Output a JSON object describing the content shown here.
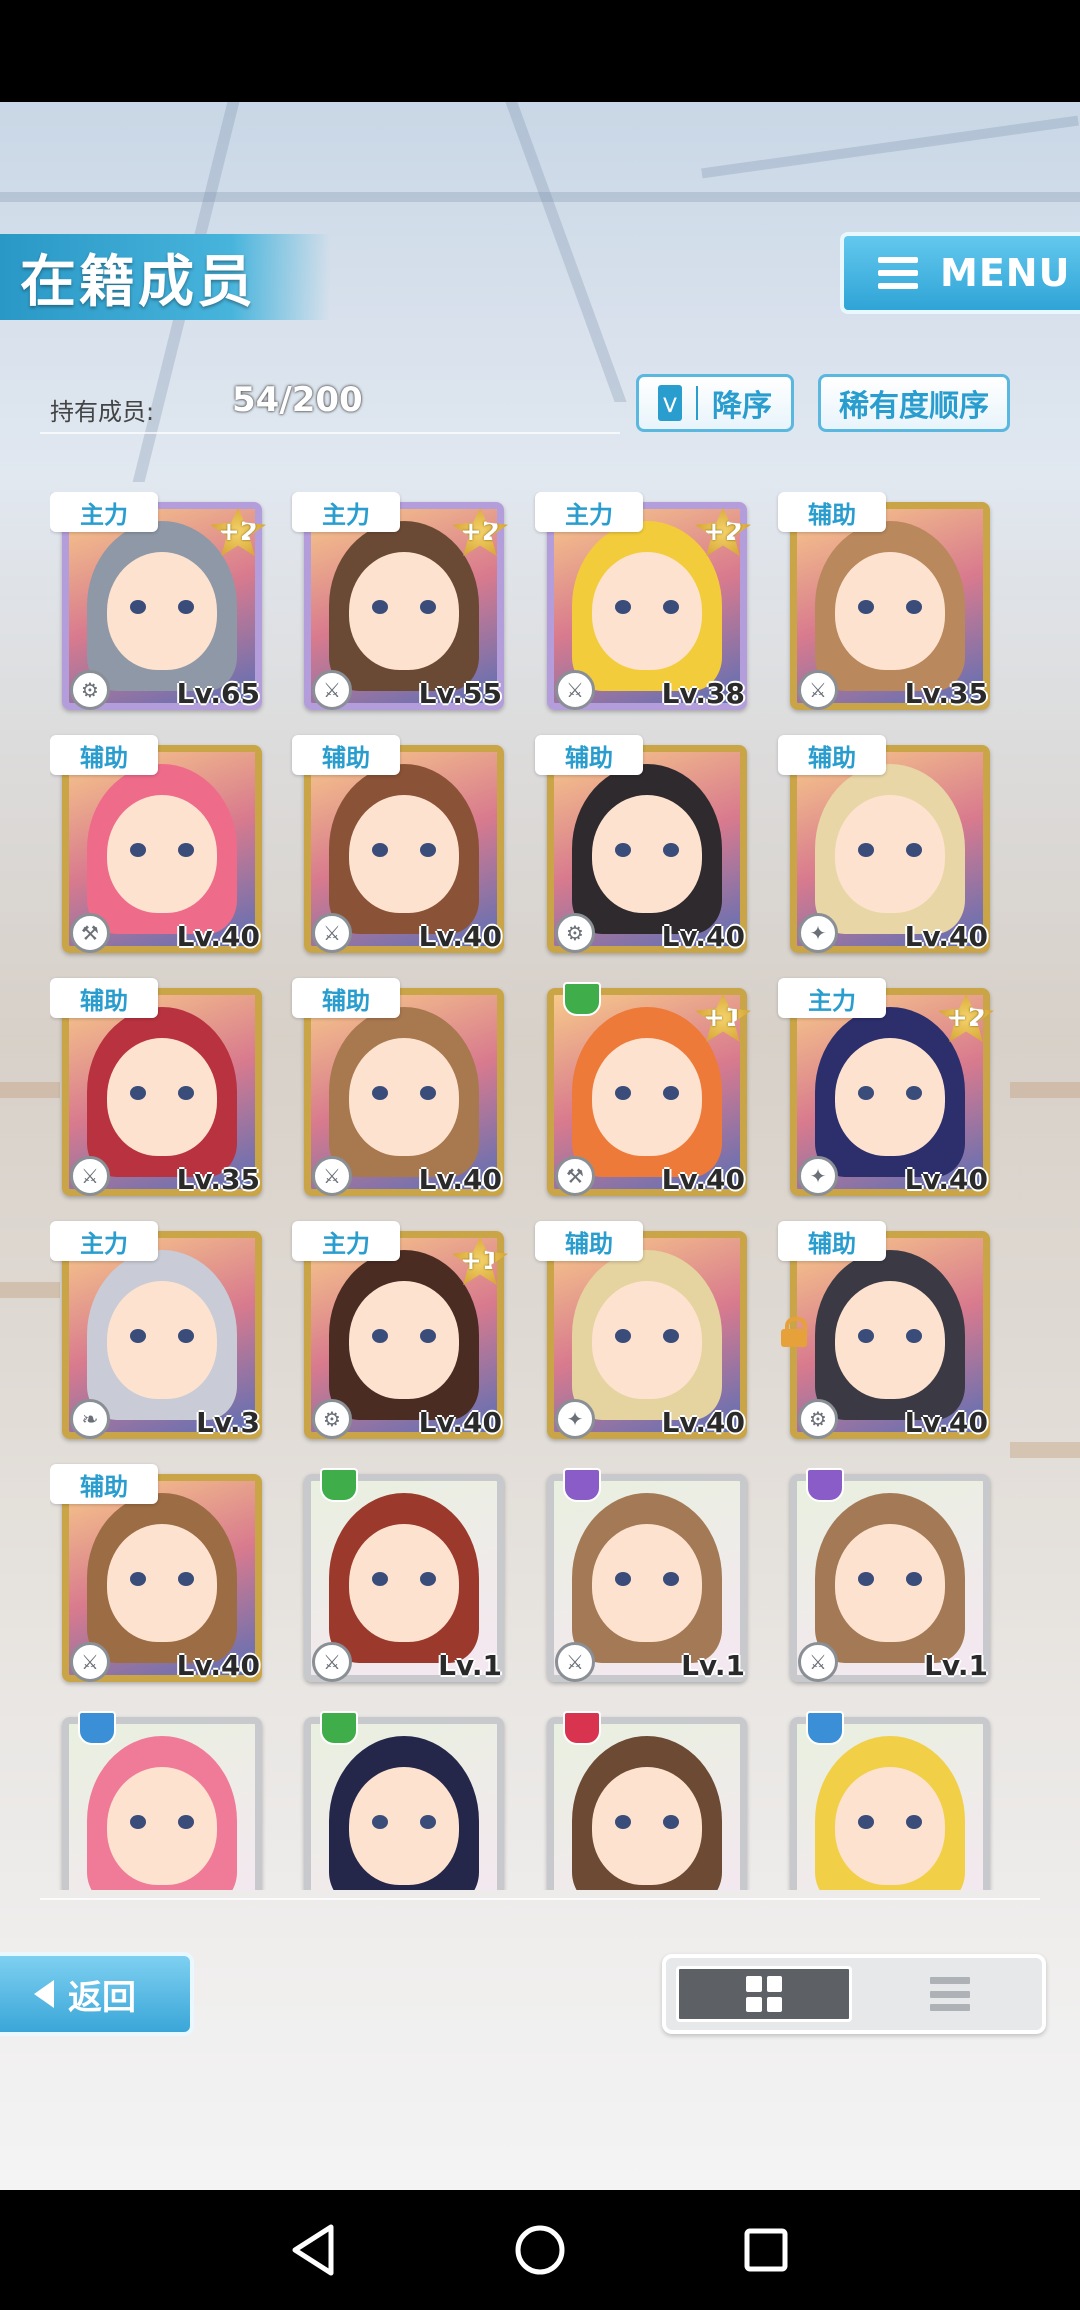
{
  "header": {
    "title": "在籍成员",
    "menu_label": "MENU"
  },
  "summary": {
    "owned_label": "持有成员:",
    "owned_count": "54/200"
  },
  "sort": {
    "order_label": "降序",
    "rarity_label": "稀有度顺序"
  },
  "cards": [
    {
      "role": "主力",
      "plus": "+2",
      "level": "Lv.65",
      "frame": "rainbow",
      "hair": "#8e98a6",
      "attr": "#8a5cc7",
      "type": "gear"
    },
    {
      "role": "主力",
      "plus": "+2",
      "level": "Lv.55",
      "frame": "rainbow",
      "hair": "#6b4a35",
      "attr": "#3a8fd6",
      "type": "sword"
    },
    {
      "role": "主力",
      "plus": "+2",
      "level": "Lv.38",
      "frame": "rainbow",
      "hair": "#f3cc3c",
      "attr": "#e29a2a",
      "type": "sword"
    },
    {
      "role": "辅助",
      "plus": "",
      "level": "Lv.35",
      "frame": "gold",
      "hair": "#b9885c",
      "attr": "#3a8fd6",
      "type": "sword"
    },
    {
      "role": "辅助",
      "plus": "",
      "level": "Lv.40",
      "frame": "gold",
      "hair": "#ee6b8a",
      "attr": "#3a8fd6",
      "type": "hammer"
    },
    {
      "role": "辅助",
      "plus": "",
      "level": "Lv.40",
      "frame": "gold",
      "hair": "#8a5236",
      "attr": "#3fae4a",
      "type": "sword"
    },
    {
      "role": "辅助",
      "plus": "",
      "level": "Lv.40",
      "frame": "gold",
      "hair": "#2f2a2e",
      "attr": "#3fae4a",
      "type": "gear"
    },
    {
      "role": "辅助",
      "plus": "",
      "level": "Lv.40",
      "frame": "gold",
      "hair": "#e8d6a6",
      "attr": "#e29a2a",
      "type": "gun"
    },
    {
      "role": "辅助",
      "plus": "",
      "level": "Lv.35",
      "frame": "gold",
      "hair": "#b8323f",
      "attr": "#e29a2a",
      "type": "sword"
    },
    {
      "role": "辅助",
      "plus": "",
      "level": "Lv.40",
      "frame": "gold",
      "hair": "#a8784f",
      "attr": "#d8344f",
      "type": "sword"
    },
    {
      "role": "",
      "plus": "+1",
      "level": "Lv.40",
      "frame": "gold",
      "hair": "#ee7a3a",
      "attr": "#3fae4a",
      "type": "hammer"
    },
    {
      "role": "主力",
      "plus": "+2",
      "level": "Lv.40",
      "frame": "gold",
      "hair": "#2c2f6b",
      "attr": "#3a8fd6",
      "type": "gun"
    },
    {
      "role": "主力",
      "plus": "",
      "level": "Lv.3",
      "frame": "gold",
      "hair": "#c9ccd6",
      "attr": "#8a5cc7",
      "type": "staff"
    },
    {
      "role": "主力",
      "plus": "+1",
      "level": "Lv.40",
      "frame": "gold",
      "hair": "#4a2c22",
      "attr": "#8a5cc7",
      "type": "gear"
    },
    {
      "role": "辅助",
      "plus": "",
      "level": "Lv.40",
      "frame": "gold",
      "hair": "#e5d3a0",
      "attr": "#d8344f",
      "type": "gun"
    },
    {
      "role": "辅助",
      "plus": "",
      "level": "Lv.40",
      "frame": "gold",
      "hair": "#3b3a44",
      "attr": "#d8344f",
      "type": "gear",
      "locked": true
    },
    {
      "role": "辅助",
      "plus": "",
      "level": "Lv.40",
      "frame": "gold",
      "hair": "#9c6c44",
      "attr": "#3a8fd6",
      "type": "sword"
    },
    {
      "role": "",
      "plus": "",
      "level": "Lv.1",
      "frame": "silver",
      "hair": "#9b3a2c",
      "attr": "#3fae4a",
      "type": "sword"
    },
    {
      "role": "",
      "plus": "",
      "level": "Lv.1",
      "frame": "silver",
      "hair": "#a37a55",
      "attr": "#8a5cc7",
      "type": "sword"
    },
    {
      "role": "",
      "plus": "",
      "level": "Lv.1",
      "frame": "silver",
      "hair": "#a37a55",
      "attr": "#8a5cc7",
      "type": "sword"
    },
    {
      "role": "",
      "plus": "",
      "level": "",
      "frame": "silver",
      "hair": "#ef7b98",
      "attr": "#3a8fd6",
      "type": ""
    },
    {
      "role": "",
      "plus": "",
      "level": "",
      "frame": "silver",
      "hair": "#25274a",
      "attr": "#3fae4a",
      "type": ""
    },
    {
      "role": "",
      "plus": "",
      "level": "",
      "frame": "silver",
      "hair": "#6c4a33",
      "attr": "#d8344f",
      "type": ""
    },
    {
      "role": "",
      "plus": "",
      "level": "",
      "frame": "silver",
      "hair": "#f1cf47",
      "attr": "#3a8fd6",
      "type": ""
    }
  ],
  "footer": {
    "back_label": "返回"
  },
  "icons": {
    "menu": "hamburger-icon",
    "order": "chevron-down-icon",
    "back": "triangle-left-icon",
    "grid_view": "grid-icon",
    "list_view": "list-icon"
  },
  "colors": {
    "accent": "#2a9dcf",
    "gold_frame": "#c9a547"
  }
}
